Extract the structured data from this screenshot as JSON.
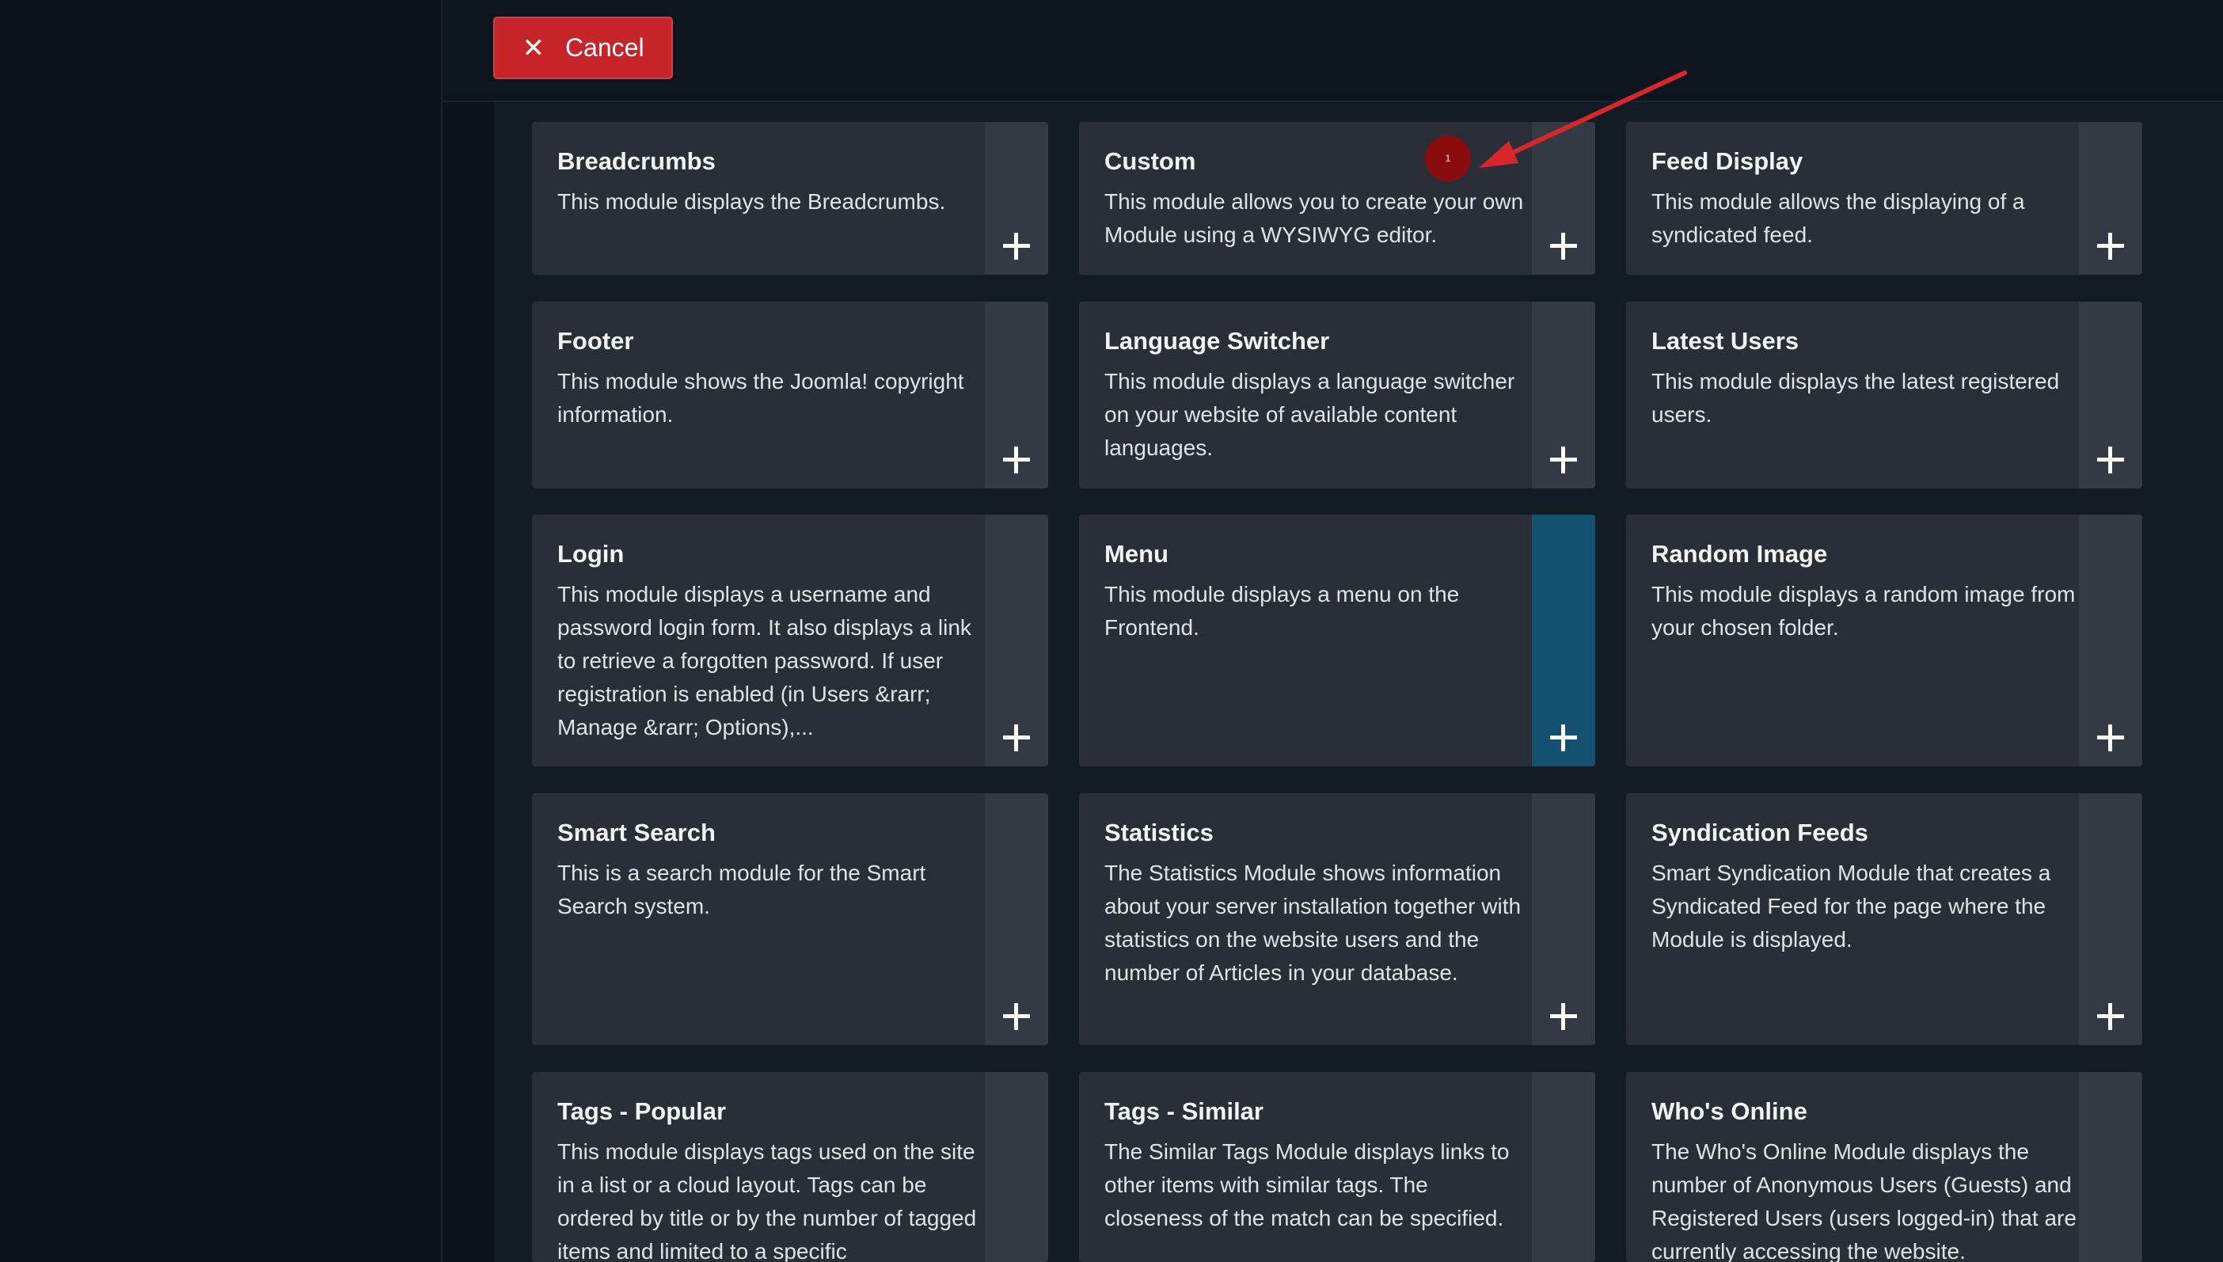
{
  "toolbar": {
    "cancel_label": "Cancel",
    "cancel_icon": "close-icon"
  },
  "annotation": {
    "marker_label": "1",
    "color": "#d9262b"
  },
  "modules": [
    {
      "title": "Breadcrumbs",
      "description": "This module displays the Breadcrumbs."
    },
    {
      "title": "Custom",
      "description": "This module allows you to create your own Module using a WYSIWYG editor."
    },
    {
      "title": "Feed Display",
      "description": "This module allows the displaying of a syndicated feed."
    },
    {
      "title": "Footer",
      "description": "This module shows the Joomla! copyright information."
    },
    {
      "title": "Language Switcher",
      "description": "This module displays a language switcher on your website of available content languages."
    },
    {
      "title": "Latest Users",
      "description": "This module displays the latest registered users."
    },
    {
      "title": "Login",
      "description": "This module displays a username and password login form. It also displays a link to retrieve a forgotten password. If user registration is enabled (in Users &rarr; Manage &rarr; Options),..."
    },
    {
      "title": "Menu",
      "description": "This module displays a menu on the Frontend.",
      "hovered": true
    },
    {
      "title": "Random Image",
      "description": "This module displays a random image from your chosen folder."
    },
    {
      "title": "Smart Search",
      "description": "This is a search module for the Smart Search system."
    },
    {
      "title": "Statistics",
      "description": "The Statistics Module shows information about your server installation together with statistics on the website users and the number of Articles in your database."
    },
    {
      "title": "Syndication Feeds",
      "description": "Smart Syndication Module that creates a Syndicated Feed for the page where the Module is displayed."
    },
    {
      "title": "Tags - Popular",
      "description": "This module displays tags used on the site in a list or a cloud layout. Tags can be ordered by title or by the number of tagged items and limited to a specific"
    },
    {
      "title": "Tags - Similar",
      "description": "The Similar Tags Module displays links to other items with similar tags. The closeness of the match can be specified."
    },
    {
      "title": "Who's Online",
      "description": "The Who's Online Module displays the number of Anonymous Users (Guests) and Registered Users (users logged-in) that are currently accessing the website."
    }
  ],
  "add_icon": "plus-icon"
}
